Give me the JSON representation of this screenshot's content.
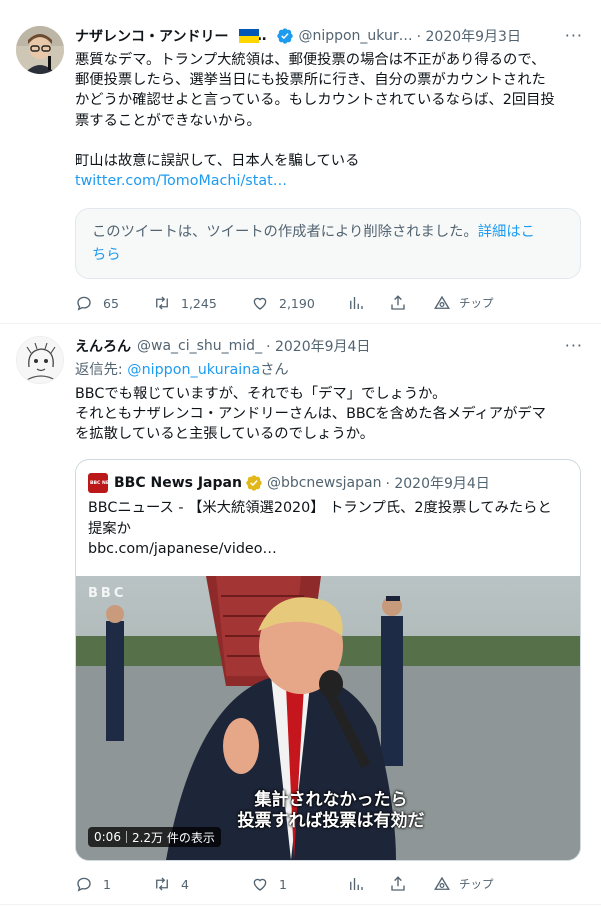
{
  "tweet1": {
    "name": "ナザレンコ・アンドリー",
    "name_ellipsis": "…",
    "handle": "@nippon_ukur…",
    "date": "· 2020年9月3日",
    "more": "···",
    "lines": [
      "悪質なデマ。トランプ大統領は、郵便投票の場合は不正があり得るので、",
      "郵便投票したら、選挙当日にも投票所に行き、自分の票がカウントされた",
      "かどうか確認せよと言っている。もしカウントされているならば、2回目投",
      "票することができないから。",
      "町山は故意に誤訳して、日本人を騙している"
    ],
    "link": "twitter.com/TomoMachi/stat…",
    "deleted_notice_1": "このツイートは、ツイートの作成者により削除されました。",
    "deleted_link_1": "詳細はこ",
    "deleted_link_2": "ちら",
    "actions": {
      "replies": "65",
      "retweets": "1,245",
      "likes": "2,190",
      "tip": "チップ"
    },
    "colors": {
      "flag_blue": "#0057b7",
      "flag_yellow": "#ffd700",
      "verified": "#1d9bf0"
    }
  },
  "tweet2": {
    "name": "えんろん",
    "handle": "@wa_ci_shu_mid_",
    "date": "· 2020年9月4日",
    "more": "···",
    "reply_prefix": "返信先: ",
    "reply_handle": "@nippon_ukuraina",
    "reply_suffix": "さん",
    "lines": [
      "BBCでも報じていますが、それでも「デマ」でしょうか。",
      "それともナザレンコ・アンドリーさんは、BBCを含めた各メディアがデマ",
      "を拡散していると主張しているのでしょうか。"
    ],
    "actions": {
      "replies": "1",
      "retweets": "4",
      "likes": "1",
      "tip": "チップ"
    }
  },
  "quote": {
    "logo_text": "BBC NEWS",
    "name": "BBC News Japan",
    "handle": "@bbcnewsjapan",
    "date": "· 2020年9月4日",
    "line1": "BBCニュース - 【米大統領選2020】 トランプ氏、2度投票してみたらと",
    "line2": "提案か",
    "url": "bbc.com/japanese/video…",
    "video_watermark": "BBC",
    "subtitle_1": "集計されなかったら",
    "subtitle_2": "投票すれば投票は有効だ",
    "duration": "0:06",
    "views": "2.2万 件の表示"
  }
}
